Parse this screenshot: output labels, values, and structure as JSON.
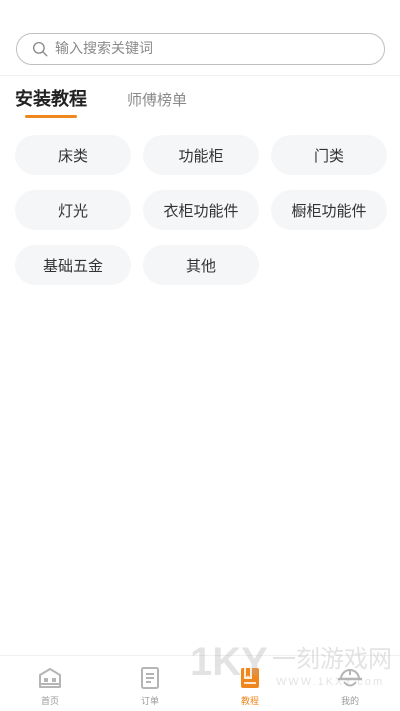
{
  "search": {
    "placeholder": "输入搜索关键词",
    "icon": "search-icon"
  },
  "tabs": [
    {
      "label": "安装教程",
      "active": true
    },
    {
      "label": "师傅榜单",
      "active": false
    }
  ],
  "categories": [
    "床类",
    "功能柜",
    "门类",
    "灯光",
    "衣柜功能件",
    "橱柜功能件",
    "基础五金",
    "其他"
  ],
  "bottom_nav": [
    {
      "label": "首页",
      "icon": "home-icon",
      "active": false
    },
    {
      "label": "订单",
      "icon": "order-icon",
      "active": false
    },
    {
      "label": "教程",
      "icon": "tutorial-icon",
      "active": true
    },
    {
      "label": "我的",
      "icon": "worker-helmet-icon",
      "active": false
    }
  ],
  "watermark": {
    "text_main": "一刻游戏网",
    "text_url": "WWW.1KXY.com",
    "logo": "1KY"
  },
  "colors": {
    "accent": "#f0871d",
    "chip_bg": "#f5f6f8",
    "inactive_icon": "#b5b5b5"
  }
}
